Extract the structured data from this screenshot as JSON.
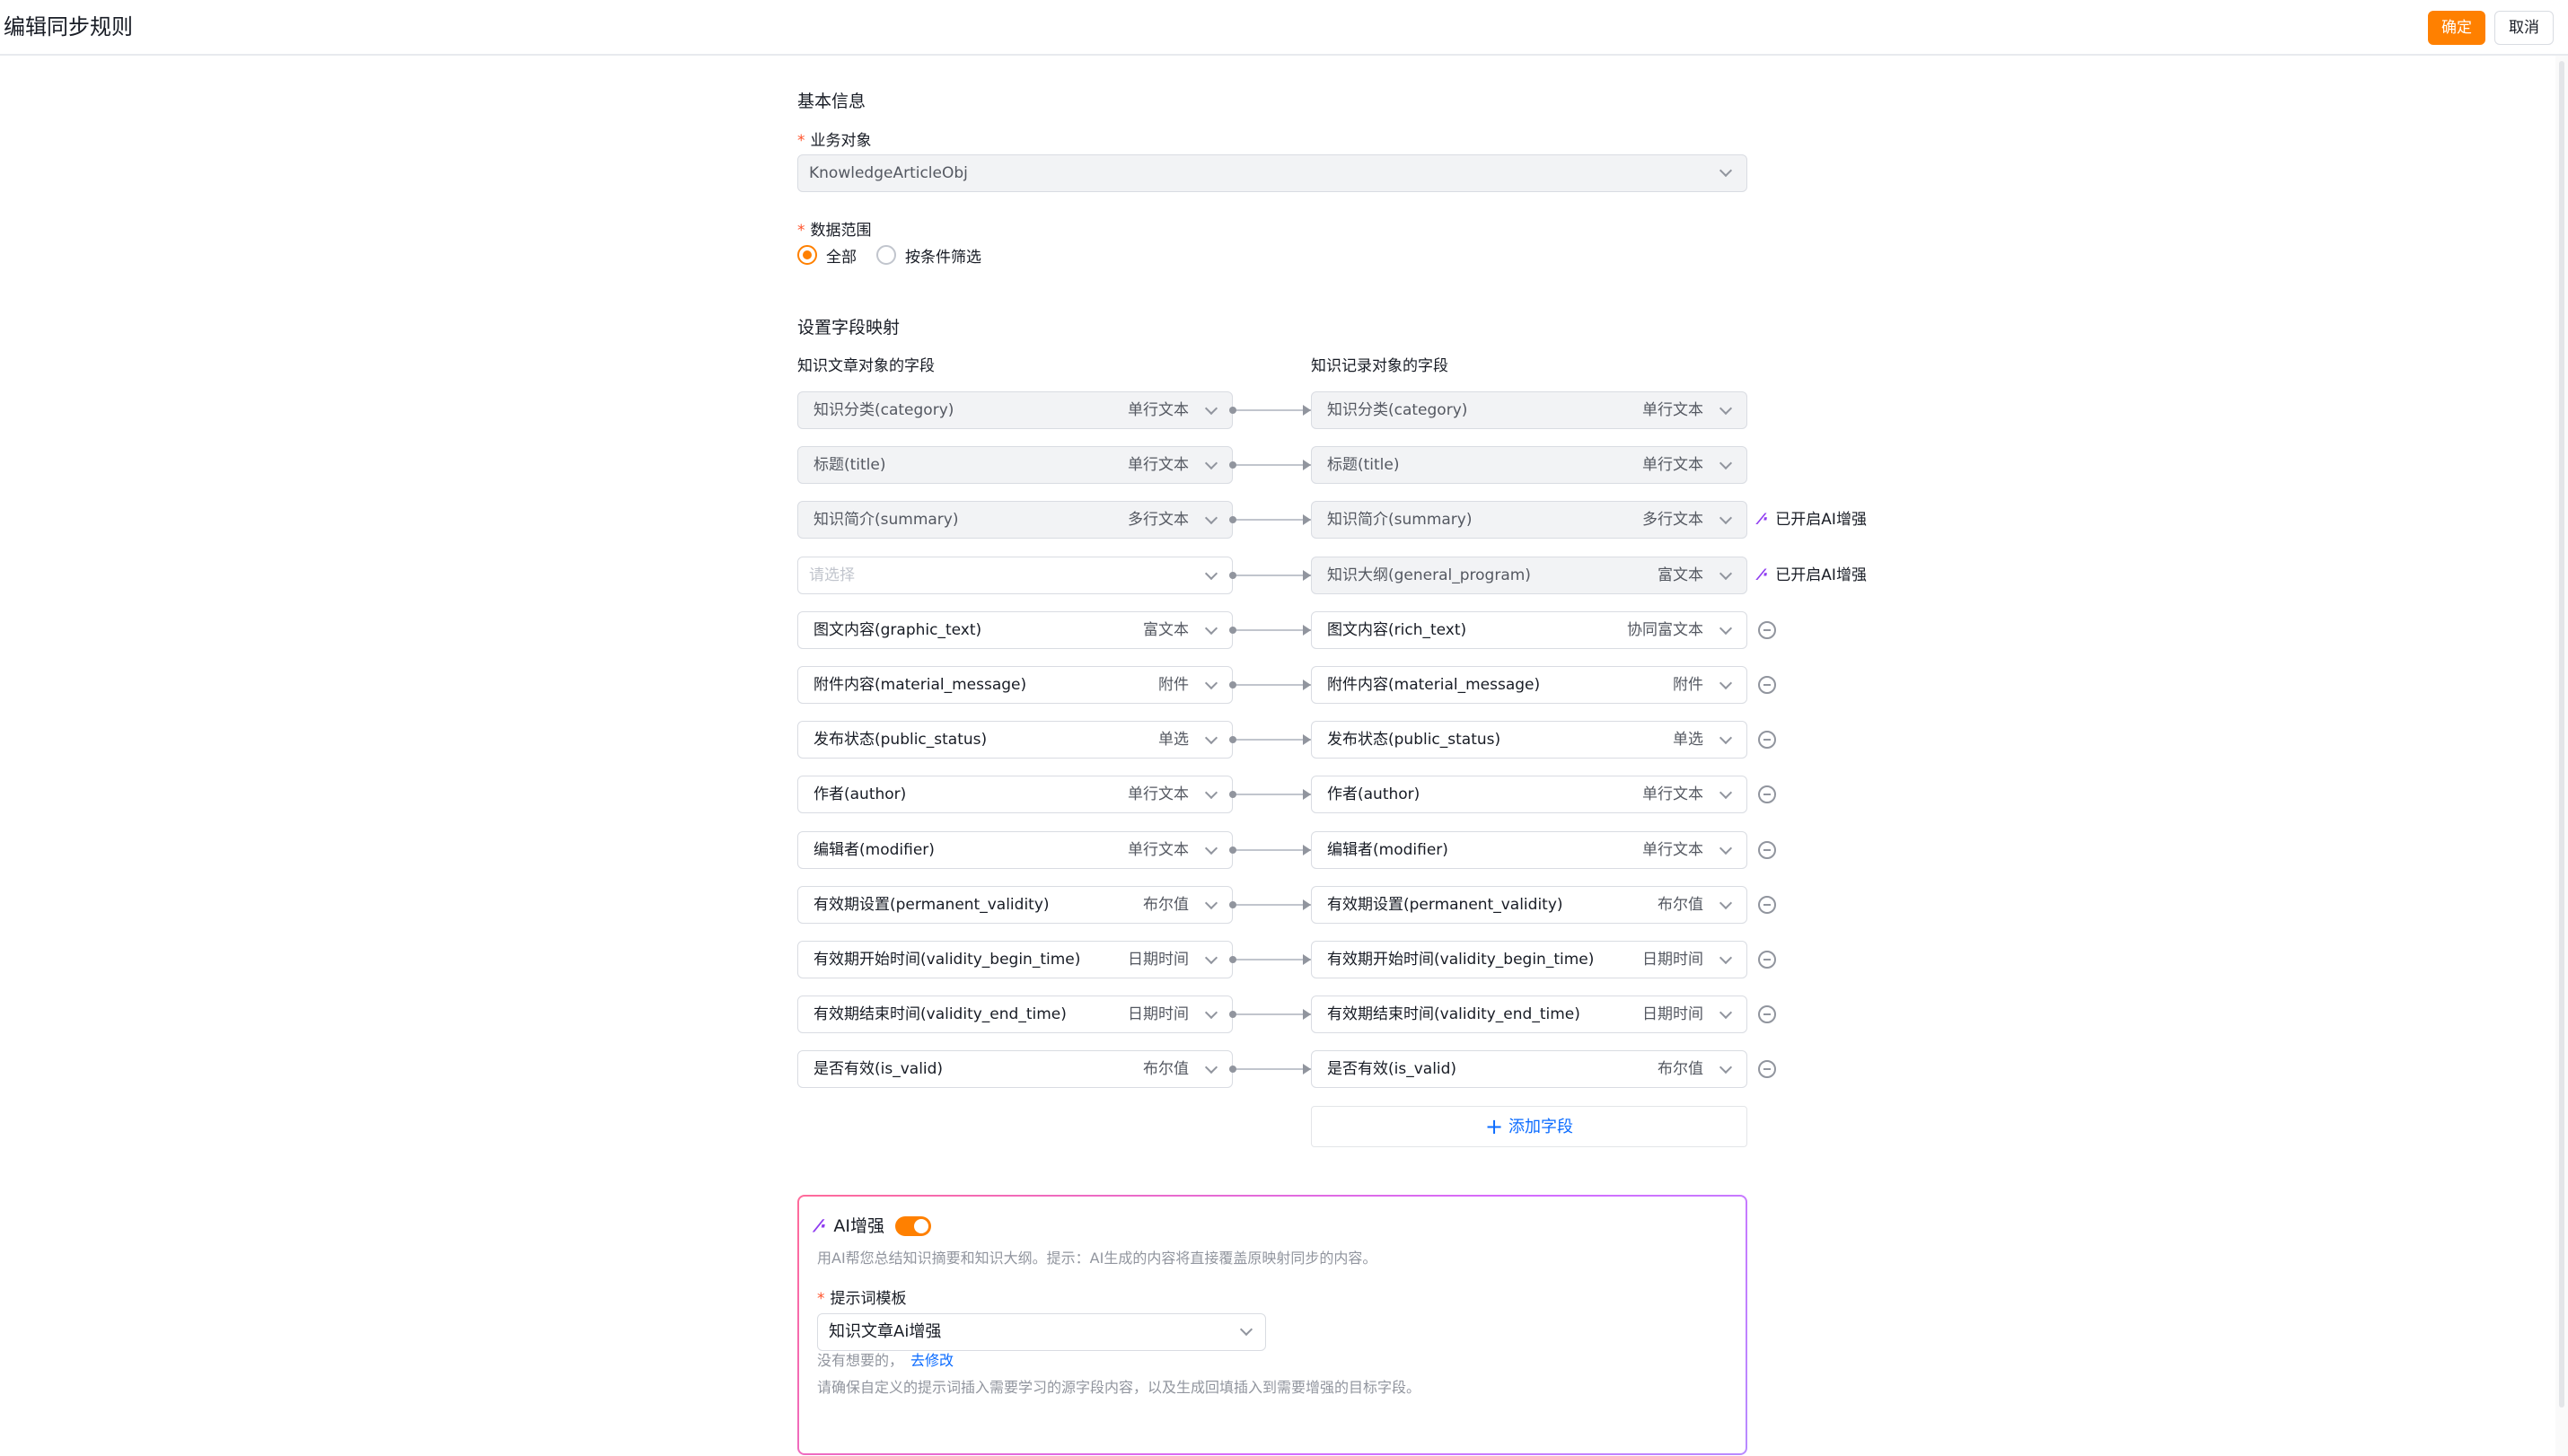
{
  "header": {
    "title": "编辑同步规则",
    "confirm_label": "确定",
    "cancel_label": "取消"
  },
  "basic": {
    "section_title": "基本信息",
    "object_label": "业务对象",
    "object_value": "KnowledgeArticleObj",
    "range_label": "数据范围",
    "range_options": [
      "全部",
      "按条件筛选"
    ],
    "range_selected": "全部"
  },
  "mapping": {
    "section_title": "设置字段映射",
    "left_header": "知识文章对象的字段",
    "right_header": "知识记录对象的字段",
    "rows": [
      {
        "left_name": "知识分类(category)",
        "left_type": "单行文本",
        "right_name": "知识分类(category)",
        "right_type": "单行文本",
        "disabled": true,
        "action": "none"
      },
      {
        "left_name": "标题(title)",
        "left_type": "单行文本",
        "right_name": "标题(title)",
        "right_type": "单行文本",
        "disabled": true,
        "action": "none"
      },
      {
        "left_name": "知识简介(summary)",
        "left_type": "多行文本",
        "right_name": "知识简介(summary)",
        "right_type": "多行文本",
        "disabled": true,
        "action": "ai",
        "ai_label": "已开启AI增强"
      },
      {
        "left_name": "",
        "left_placeholder": "请选择",
        "left_type": "",
        "right_name": "知识大纲(general_program)",
        "right_type": "富文本",
        "disabled": false,
        "right_disabled": true,
        "action": "ai",
        "ai_label": "已开启AI增强"
      },
      {
        "left_name": "图文内容(graphic_text)",
        "left_type": "富文本",
        "right_name": "图文内容(rich_text)",
        "right_type": "协同富文本",
        "action": "remove"
      },
      {
        "left_name": "附件内容(material_message)",
        "left_type": "附件",
        "right_name": "附件内容(material_message)",
        "right_type": "附件",
        "action": "remove"
      },
      {
        "left_name": "发布状态(public_status)",
        "left_type": "单选",
        "right_name": "发布状态(public_status)",
        "right_type": "单选",
        "action": "remove"
      },
      {
        "left_name": "作者(author)",
        "left_type": "单行文本",
        "right_name": "作者(author)",
        "right_type": "单行文本",
        "action": "remove"
      },
      {
        "left_name": "编辑者(modifier)",
        "left_type": "单行文本",
        "right_name": "编辑者(modifier)",
        "right_type": "单行文本",
        "action": "remove"
      },
      {
        "left_name": "有效期设置(permanent_validity)",
        "left_type": "布尔值",
        "right_name": "有效期设置(permanent_validity)",
        "right_type": "布尔值",
        "action": "remove"
      },
      {
        "left_name": "有效期开始时间(validity_begin_time)",
        "left_type": "日期时间",
        "right_name": "有效期开始时间(validity_begin_time)",
        "right_type": "日期时间",
        "action": "remove"
      },
      {
        "left_name": "有效期结束时间(validity_end_time)",
        "left_type": "日期时间",
        "right_name": "有效期结束时间(validity_end_time)",
        "right_type": "日期时间",
        "action": "remove"
      },
      {
        "left_name": "是否有效(is_valid)",
        "left_type": "布尔值",
        "right_name": "是否有效(is_valid)",
        "right_type": "布尔值",
        "action": "remove"
      }
    ],
    "add_field_label": "添加字段"
  },
  "ai": {
    "title": "AI增强",
    "enabled": true,
    "description": "用AI帮您总结知识摘要和知识大纲。提示：AI生成的内容将直接覆盖原映射同步的内容。",
    "template_label": "提示词模板",
    "template_value": "知识文章Ai增强",
    "hint_text": "没有想要的，",
    "hint_link": "去修改",
    "note": "请确保自定义的提示词插入需要学习的源字段内容，以及生成回填插入到需要增强的目标字段。"
  },
  "colors": {
    "accent": "#ff8000",
    "link": "#0c6cff",
    "ai_purple": "#8f3cf0",
    "required": "#ff522a"
  }
}
